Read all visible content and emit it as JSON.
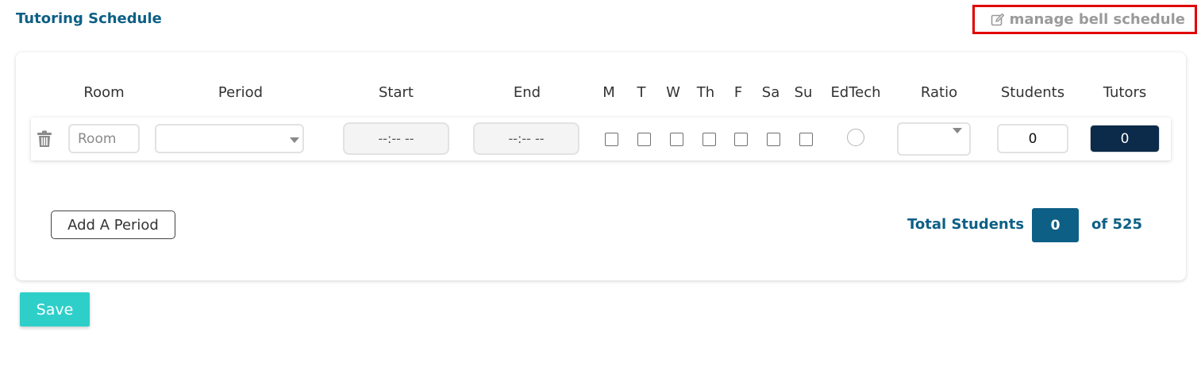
{
  "header": {
    "title": "Tutoring Schedule",
    "manage_link": "manage bell schedule",
    "manage_icon": "edit-icon"
  },
  "table": {
    "columns": [
      "Room",
      "Period",
      "Start",
      "End",
      "M",
      "T",
      "W",
      "Th",
      "F",
      "Sa",
      "Su",
      "EdTech",
      "Ratio",
      "Students",
      "Tutors"
    ],
    "row": {
      "room_placeholder": "Room",
      "period_value": "",
      "start_value": "--:-- --",
      "end_value": "--:-- --",
      "days_checked": [
        false,
        false,
        false,
        false,
        false,
        false,
        false
      ],
      "edtech_selected": false,
      "ratio_value": "",
      "students_value": "0",
      "tutors_value": "0"
    }
  },
  "actions": {
    "add_period_label": "Add A Period",
    "save_label": "Save"
  },
  "totals": {
    "label": "Total Students",
    "value": "0",
    "of_text": "of 525"
  },
  "colors": {
    "brand": "#0e5f86",
    "highlight_border": "#e00000",
    "tutors_bg": "#0c2a49",
    "save_bg": "#2fcfc9"
  }
}
